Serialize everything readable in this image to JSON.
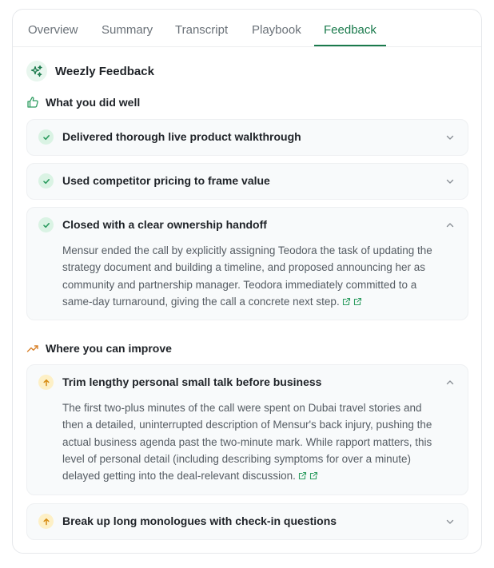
{
  "tabs": [
    {
      "label": "Overview"
    },
    {
      "label": "Summary"
    },
    {
      "label": "Transcript"
    },
    {
      "label": "Playbook"
    },
    {
      "label": "Feedback",
      "active": true
    }
  ],
  "brand": {
    "title": "Weezly Feedback",
    "icon": "sparkle-icon"
  },
  "well": {
    "heading": "What you did well",
    "icon": "thumbs-up-icon",
    "items": [
      {
        "title": "Delivered thorough live product walkthrough",
        "expanded": false
      },
      {
        "title": "Used competitor pricing to frame value",
        "expanded": false
      },
      {
        "title": "Closed with a clear ownership handoff",
        "expanded": true,
        "body": [
          "Mensur ended the call by explicitly assigning Teodora the task of updating the",
          "strategy document and building a timeline, and proposed announcing her as",
          "community and partnership manager. Teodora immediately committed to a",
          "same-day turnaround, giving the call a concrete next step."
        ]
      }
    ]
  },
  "improve": {
    "heading": "Where you can improve",
    "icon": "trending-up-icon",
    "items": [
      {
        "title": "Trim lengthy personal small talk before business",
        "expanded": true,
        "body": [
          "The first two-plus minutes of the call were spent on Dubai travel stories and",
          "then a detailed, uninterrupted description of Mensur's back injury, pushing the",
          "actual business agenda past the two-minute mark. While rapport matters, this",
          "level of personal detail (including describing symptoms for over a minute)",
          "delayed getting into the deal-relevant discussion."
        ]
      },
      {
        "title": "Break up long monologues with check-in questions",
        "expanded": false
      }
    ]
  },
  "colors": {
    "accent": "#1a7a4c",
    "good": "#2e9d61",
    "warn": "#d68a10",
    "improve": "#d9822b"
  }
}
